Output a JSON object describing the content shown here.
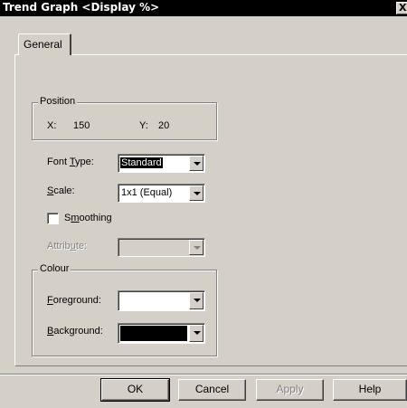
{
  "window": {
    "title": "Trend Graph <Display %>",
    "close_label": "X"
  },
  "tabs": [
    {
      "label": "General"
    }
  ],
  "position": {
    "group_label": "Position",
    "x_label": "X:",
    "x_value": "150",
    "y_label": "Y:",
    "y_value": "20"
  },
  "font_type": {
    "label_pre": "Font ",
    "label_u": "T",
    "label_post": "ype:",
    "value": "Standard"
  },
  "scale": {
    "label_pre": "",
    "label_u": "S",
    "label_post": "cale:",
    "value": "1x1 (Equal)"
  },
  "smoothing": {
    "label_pre": "S",
    "label_u": "m",
    "label_post": "oothing",
    "checked": false
  },
  "attribute": {
    "label_pre": "Attrib",
    "label_u": "u",
    "label_post": "te:",
    "value": "",
    "enabled": false
  },
  "colour": {
    "group_label": "Colour",
    "foreground": {
      "label_pre": "",
      "label_u": "F",
      "label_post": "oreground:",
      "color": "#ffffff"
    },
    "background": {
      "label_pre": "",
      "label_u": "B",
      "label_post": "ackground:",
      "color": "#000000"
    }
  },
  "buttons": {
    "ok": "OK",
    "cancel": "Cancel",
    "apply": "Apply",
    "help": "Help"
  }
}
